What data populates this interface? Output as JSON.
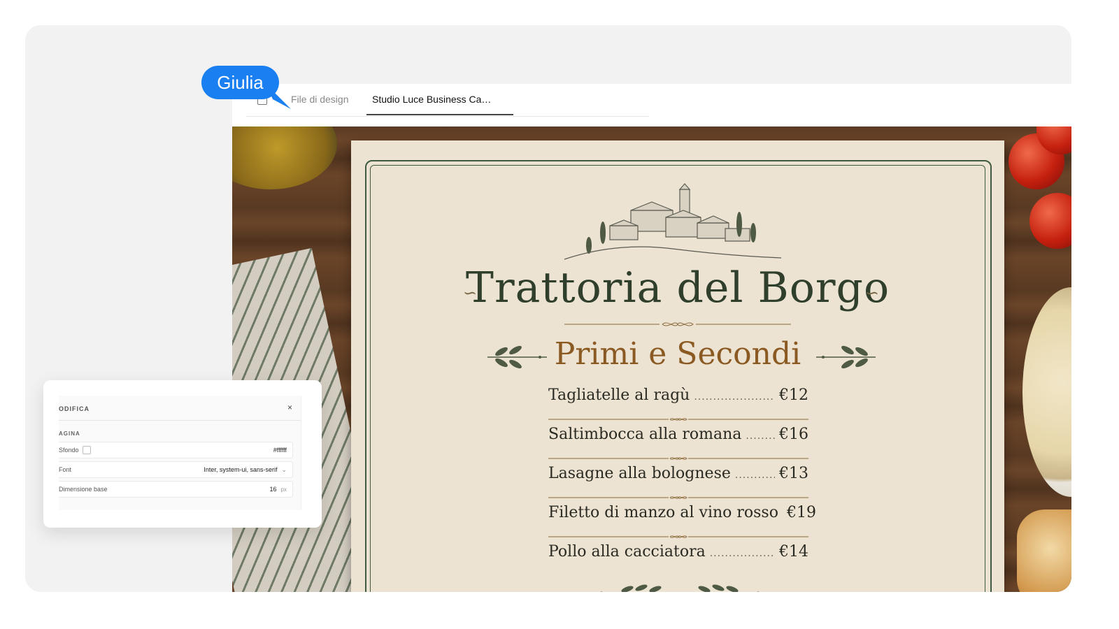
{
  "tabs": [
    {
      "label": "File di design"
    },
    {
      "label": "Studio Luce Business Ca…"
    }
  ],
  "collaborator": {
    "name": "Giulia"
  },
  "menu": {
    "title": "Trattoria del Borgo",
    "subtitle": "Primi e Secondi",
    "items": [
      {
        "name": "Tagliatelle al ragù",
        "price": "€12"
      },
      {
        "name": "Saltimbocca alla romana",
        "price": "€16"
      },
      {
        "name": "Lasagne alla bolognese",
        "price": "€13"
      },
      {
        "name": "Filetto di manzo al vino rosso",
        "price": "€19"
      },
      {
        "name": "Pollo alla cacciatora",
        "price": "€14"
      }
    ]
  },
  "panel": {
    "title": "ODIFICA",
    "close_icon": "×",
    "section": "AGINA",
    "props": [
      {
        "label": "Sfondo",
        "value": "#ffffff"
      },
      {
        "label": "Font",
        "value": "Inter, system-ui, sans-serif"
      },
      {
        "label": "Dimensione base",
        "value": "16",
        "unit": "px"
      }
    ]
  },
  "colors": {
    "accent": "#1a7ff0",
    "menu_green": "#2f3f2c",
    "menu_brown": "#8b5a23"
  }
}
